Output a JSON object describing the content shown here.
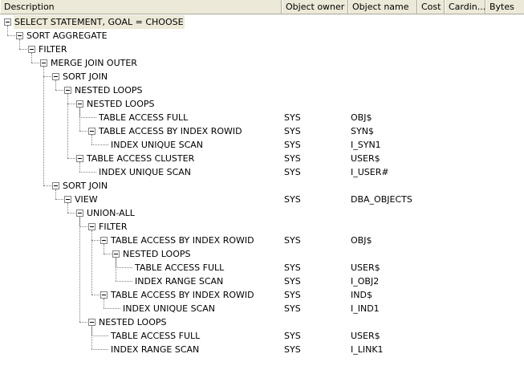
{
  "columns": {
    "description": "Description",
    "object_owner": "Object owner",
    "object_name": "Object name",
    "cost": "Cost",
    "cardinality": "Cardin...",
    "bytes": "Bytes"
  },
  "rows": [
    {
      "text": "SELECT STATEMENT, GOAL = CHOOSE",
      "owner": "",
      "name": "",
      "depth": 0,
      "expandable": true,
      "selected": true
    },
    {
      "text": "SORT AGGREGATE",
      "owner": "",
      "name": "",
      "depth": 1,
      "expandable": true
    },
    {
      "text": "FILTER",
      "owner": "",
      "name": "",
      "depth": 2,
      "expandable": true
    },
    {
      "text": "MERGE JOIN OUTER",
      "owner": "",
      "name": "",
      "depth": 3,
      "expandable": true
    },
    {
      "text": "SORT JOIN",
      "owner": "",
      "name": "",
      "depth": 4,
      "expandable": true
    },
    {
      "text": "NESTED LOOPS",
      "owner": "",
      "name": "",
      "depth": 5,
      "expandable": true
    },
    {
      "text": "NESTED LOOPS",
      "owner": "",
      "name": "",
      "depth": 6,
      "expandable": true
    },
    {
      "text": "TABLE ACCESS FULL",
      "owner": "SYS",
      "name": "OBJ$",
      "depth": 7,
      "expandable": false
    },
    {
      "text": "TABLE ACCESS BY INDEX ROWID",
      "owner": "SYS",
      "name": "SYN$",
      "depth": 7,
      "expandable": true
    },
    {
      "text": "INDEX UNIQUE SCAN",
      "owner": "SYS",
      "name": "I_SYN1",
      "depth": 8,
      "expandable": false
    },
    {
      "text": "TABLE ACCESS CLUSTER",
      "owner": "SYS",
      "name": "USER$",
      "depth": 6,
      "expandable": true
    },
    {
      "text": "INDEX UNIQUE SCAN",
      "owner": "SYS",
      "name": "I_USER#",
      "depth": 7,
      "expandable": false
    },
    {
      "text": "SORT JOIN",
      "owner": "",
      "name": "",
      "depth": 4,
      "expandable": true
    },
    {
      "text": "VIEW",
      "owner": "SYS",
      "name": "DBA_OBJECTS",
      "depth": 5,
      "expandable": true
    },
    {
      "text": "UNION-ALL",
      "owner": "",
      "name": "",
      "depth": 6,
      "expandable": true
    },
    {
      "text": "FILTER",
      "owner": "",
      "name": "",
      "depth": 7,
      "expandable": true
    },
    {
      "text": "TABLE ACCESS BY INDEX ROWID",
      "owner": "SYS",
      "name": "OBJ$",
      "depth": 8,
      "expandable": true
    },
    {
      "text": "NESTED LOOPS",
      "owner": "",
      "name": "",
      "depth": 9,
      "expandable": true
    },
    {
      "text": "TABLE ACCESS FULL",
      "owner": "SYS",
      "name": "USER$",
      "depth": 10,
      "expandable": false
    },
    {
      "text": "INDEX RANGE SCAN",
      "owner": "SYS",
      "name": "I_OBJ2",
      "depth": 10,
      "expandable": false
    },
    {
      "text": "TABLE ACCESS BY INDEX ROWID",
      "owner": "SYS",
      "name": "IND$",
      "depth": 8,
      "expandable": true
    },
    {
      "text": "INDEX UNIQUE SCAN",
      "owner": "SYS",
      "name": "I_IND1",
      "depth": 9,
      "expandable": false
    },
    {
      "text": "NESTED LOOPS",
      "owner": "",
      "name": "",
      "depth": 7,
      "expandable": true
    },
    {
      "text": "TABLE ACCESS FULL",
      "owner": "SYS",
      "name": "USER$",
      "depth": 8,
      "expandable": false
    },
    {
      "text": "INDEX RANGE SCAN",
      "owner": "SYS",
      "name": "I_LINK1",
      "depth": 8,
      "expandable": false
    }
  ],
  "icons": {
    "expand_toggle": "minus-box-icon"
  },
  "colors": {
    "header_bg": "#ece9d8",
    "selection_bg": "#ece9d8",
    "tree_line": "#808080"
  }
}
